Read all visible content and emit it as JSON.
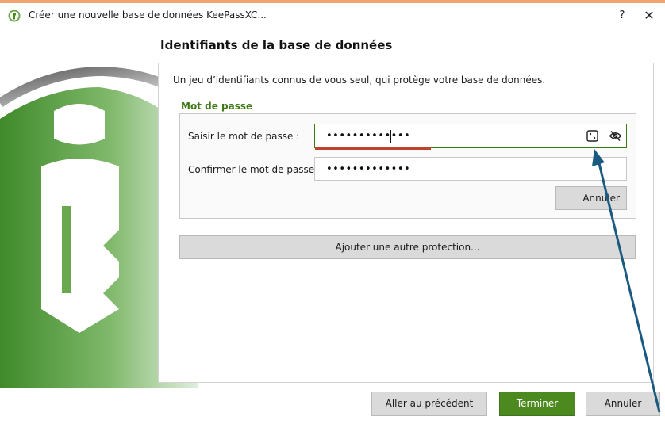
{
  "window": {
    "title": "Créer une nouvelle base de données KeePassXC...",
    "help_label": "?",
    "close_label": "✕",
    "app_icon": "keepassxc-logo-icon"
  },
  "page": {
    "heading": "Identifiants de la base de données",
    "description": "Un jeu d’identifiants connus de vous seul, qui protège votre base de données."
  },
  "password_group": {
    "title": "Mot de passe",
    "enter_label": "Saisir le mot de passe :",
    "confirm_label": "Confirmer le mot de passe :",
    "password_masked": "•••••••••••••",
    "confirm_masked": "•••••••••••••",
    "generate_icon": "dice-icon",
    "toggle_icon": "eye-slash-icon",
    "cancel_button": "Annuler",
    "strength_color": "#c0422a"
  },
  "add_protection_button": "Ajouter une autre protection...",
  "footer": {
    "back_button": "Aller au précédent",
    "finish_button": "Terminer",
    "cancel_button": "Annuler"
  },
  "colors": {
    "accent": "#4c8a1f",
    "group_title": "#3d7a14",
    "annotation_arrow": "#1b5a80"
  }
}
